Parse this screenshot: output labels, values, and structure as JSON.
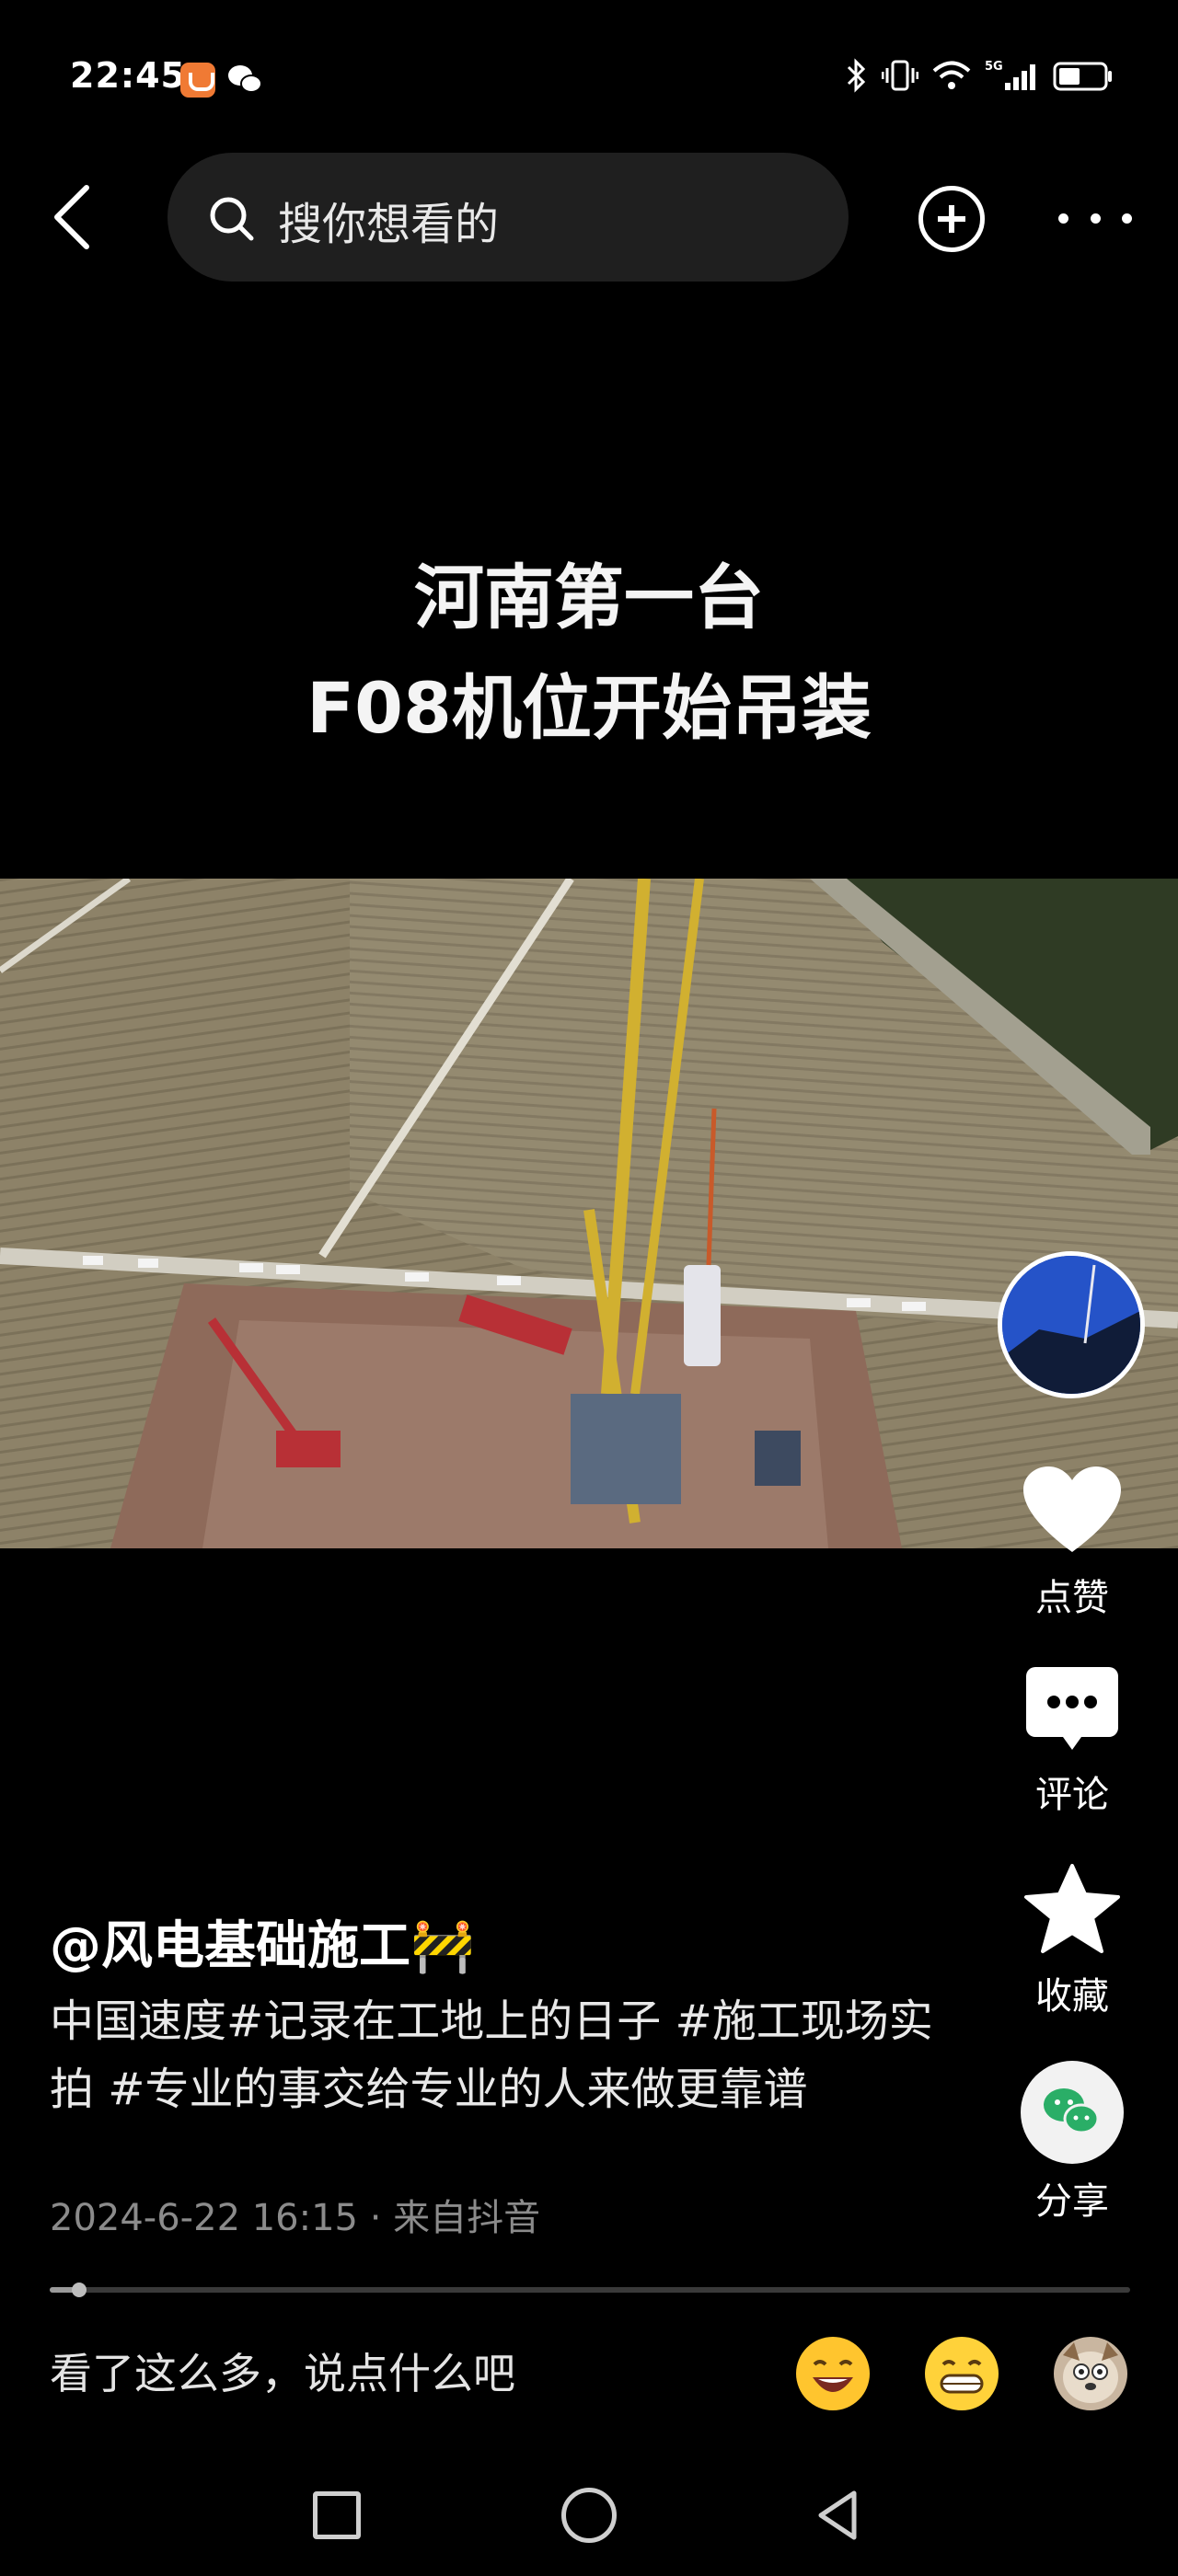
{
  "status_bar": {
    "time": "22:45",
    "network": "5G",
    "icons": [
      "bluetooth-icon",
      "vibrate-icon",
      "wifi-icon",
      "signal-icon",
      "battery-icon"
    ]
  },
  "top_nav": {
    "search_placeholder": "搜你想看的"
  },
  "video": {
    "title_line1": "河南第一台",
    "title_line2": "F08机位开始吊装"
  },
  "actions": {
    "like_label": "点赞",
    "comment_label": "评论",
    "favorite_label": "收藏",
    "share_label": "分享"
  },
  "post": {
    "author": "@风电基础施工🚧",
    "caption": "中国速度#记录在工地上的日子 #施工现场实拍 #专业的事交给专业的人来做更靠谱",
    "meta": "2024-6-22 16:15 · 来自抖音"
  },
  "playback": {
    "progress_fraction": 0.027
  },
  "comment_bar": {
    "placeholder": "看了这么多，说点什么吧",
    "emojis": [
      "laughing-emoji",
      "grinning-emoji",
      "dog-emoji"
    ]
  },
  "colors": {
    "background": "#000000",
    "search_bg": "#1f1f1f",
    "meta_text": "#8b8b8b"
  }
}
